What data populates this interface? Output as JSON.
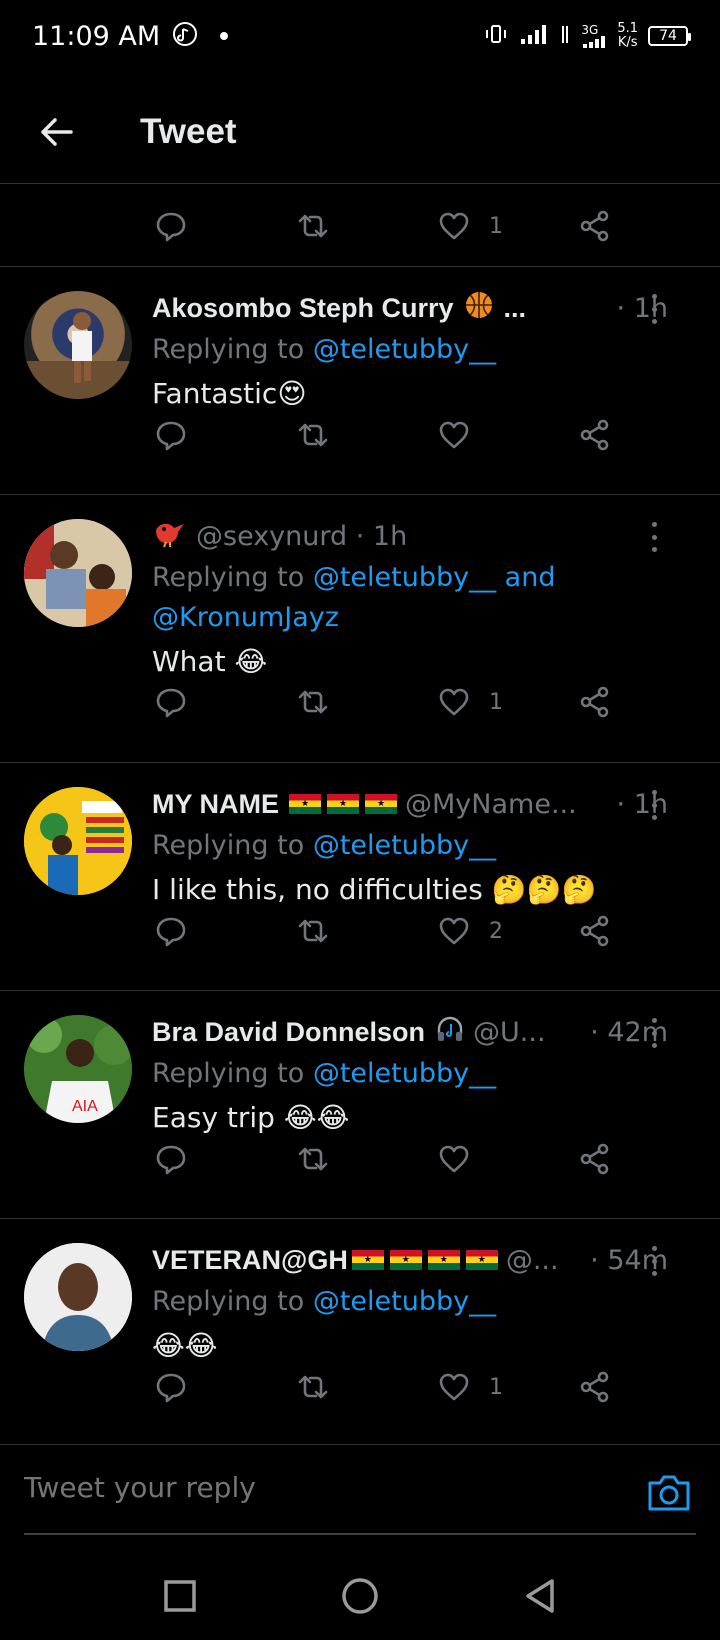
{
  "status_bar": {
    "time": "11:09 AM",
    "network": "3G",
    "speed_value": "5.1",
    "speed_unit": "K/s",
    "battery": "74"
  },
  "header": {
    "title": "Tweet"
  },
  "top_actions": {
    "like_count": "1"
  },
  "tweets": [
    {
      "name": "Akosombo Steph Curry",
      "name_suffix": "...",
      "handle": "",
      "time": "· 1h",
      "replying_prefix": "Replying to ",
      "mentions": "@teletubby__",
      "text": "Fantastic😍",
      "reply_count": "",
      "retweet_count": "",
      "like_count": ""
    },
    {
      "name": "",
      "handle": "@sexynurd · 1h",
      "time": "",
      "replying_prefix": "Replying to ",
      "mentions": "@teletubby__ and @KronumJayz",
      "text": "What 😂",
      "like_count": "1"
    },
    {
      "name": "MY NAME",
      "handle": "@MyName...",
      "time": "· 1h",
      "replying_prefix": "Replying to ",
      "mentions": "@teletubby__",
      "text": "I like this, no difficulties 🤔🤔🤔",
      "like_count": "2"
    },
    {
      "name": "Bra David Donnelson",
      "handle": "@U...",
      "time": "· 42m",
      "replying_prefix": "Replying to ",
      "mentions": "@teletubby__",
      "text": "Easy trip 😂😂",
      "like_count": ""
    },
    {
      "name": "VETERAN@GH",
      "handle": "@...",
      "time": "· 54m",
      "replying_prefix": "Replying to ",
      "mentions": "@teletubby__",
      "text": "😂😂",
      "like_count": "1"
    }
  ],
  "reply_bar": {
    "placeholder": "Tweet your reply"
  },
  "colors": {
    "accent": "#1d9bf0",
    "muted": "#71767b",
    "background": "#000000"
  },
  "icons": [
    "back-arrow-icon",
    "reply-icon",
    "retweet-icon",
    "heart-icon",
    "share-icon",
    "more-icon",
    "camera-icon",
    "basketball-icon",
    "headphones-icon",
    "ghana-flag-icon"
  ]
}
